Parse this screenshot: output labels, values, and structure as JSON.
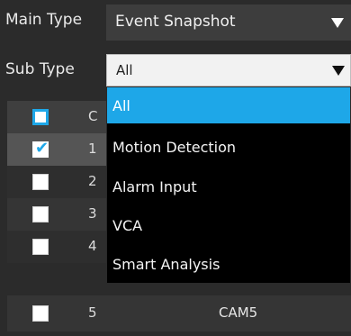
{
  "main_type": {
    "label": "Main Type",
    "value": "Event Snapshot"
  },
  "sub_type": {
    "label": "Sub Type",
    "value": "All"
  },
  "dropdown": {
    "options": [
      "All",
      "Motion Detection",
      "Alarm Input",
      "VCA",
      "Smart Analysis"
    ],
    "active_index": 0
  },
  "table": {
    "header_no_partial": "C",
    "rows": [
      {
        "no": "1",
        "checked": true
      },
      {
        "no": "2",
        "checked": false
      },
      {
        "no": "3",
        "checked": false
      },
      {
        "no": "4",
        "checked": false
      },
      {
        "no": "5",
        "name": "CAM5",
        "checked": false
      }
    ]
  },
  "colors": {
    "accent": "#1ea7e8",
    "background": "#2b2b2b",
    "dropdown_bg": "#000000"
  }
}
